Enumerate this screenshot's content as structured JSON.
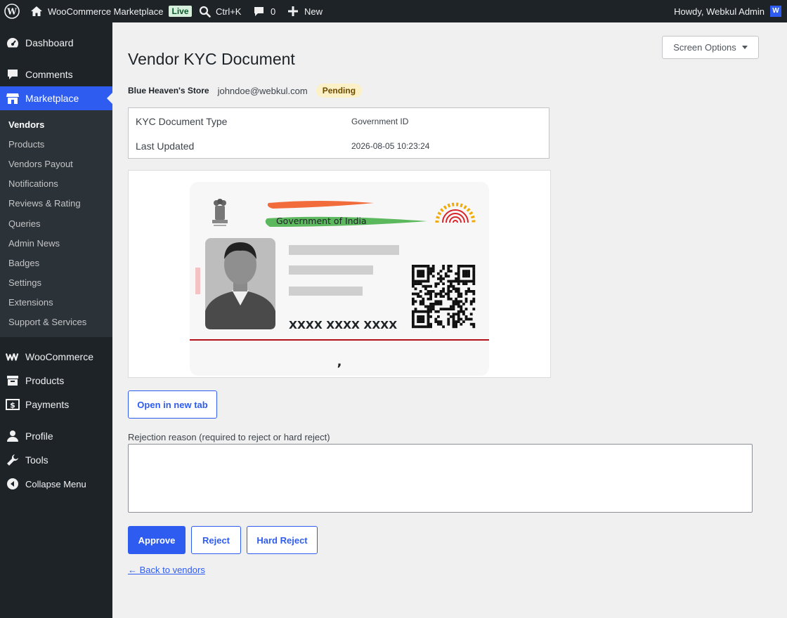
{
  "adminbar": {
    "site_name": "WooCommerce Marketplace",
    "live_badge": "Live",
    "search_shortcut": "Ctrl+K",
    "comments_count": "0",
    "new_label": "New",
    "howdy": "Howdy, Webkul Admin",
    "avatar_letter": "W"
  },
  "sidebar": {
    "dashboard": "Dashboard",
    "comments": "Comments",
    "marketplace": "Marketplace",
    "submenu": [
      "Vendors",
      "Products",
      "Vendors Payout",
      "Notifications",
      "Reviews & Rating",
      "Queries",
      "Admin News",
      "Badges",
      "Settings",
      "Extensions",
      "Support & Services"
    ],
    "woocommerce": "WooCommerce",
    "products": "Products",
    "payments": "Payments",
    "profile": "Profile",
    "tools": "Tools",
    "collapse": "Collapse Menu"
  },
  "main": {
    "screen_options": "Screen Options",
    "title": "Vendor KYC Document",
    "store_name": "Blue Heaven's Store",
    "store_email": "johndoe@webkul.com",
    "status": "Pending",
    "table": [
      {
        "key": "KYC Document Type",
        "value": "Government ID"
      },
      {
        "key": "Last Updated",
        "value": "2026-08-05 10:23:24"
      }
    ],
    "document": {
      "header_text": "Government of India",
      "id_number": "XXXX XXXX XXXX",
      "footer_mark": ","
    },
    "open_tab_label": "Open in new tab",
    "reason_label": "Rejection reason (required to reject or hard reject)",
    "reason_value": "",
    "approve_label": "Approve",
    "reject_label": "Reject",
    "hard_reject_label": "Hard Reject",
    "back_label": "← Back to vendors"
  },
  "colors": {
    "accent": "#2f5cf0",
    "sidebar_bg": "#1d2327",
    "pending_bg": "#fcf0c7"
  }
}
